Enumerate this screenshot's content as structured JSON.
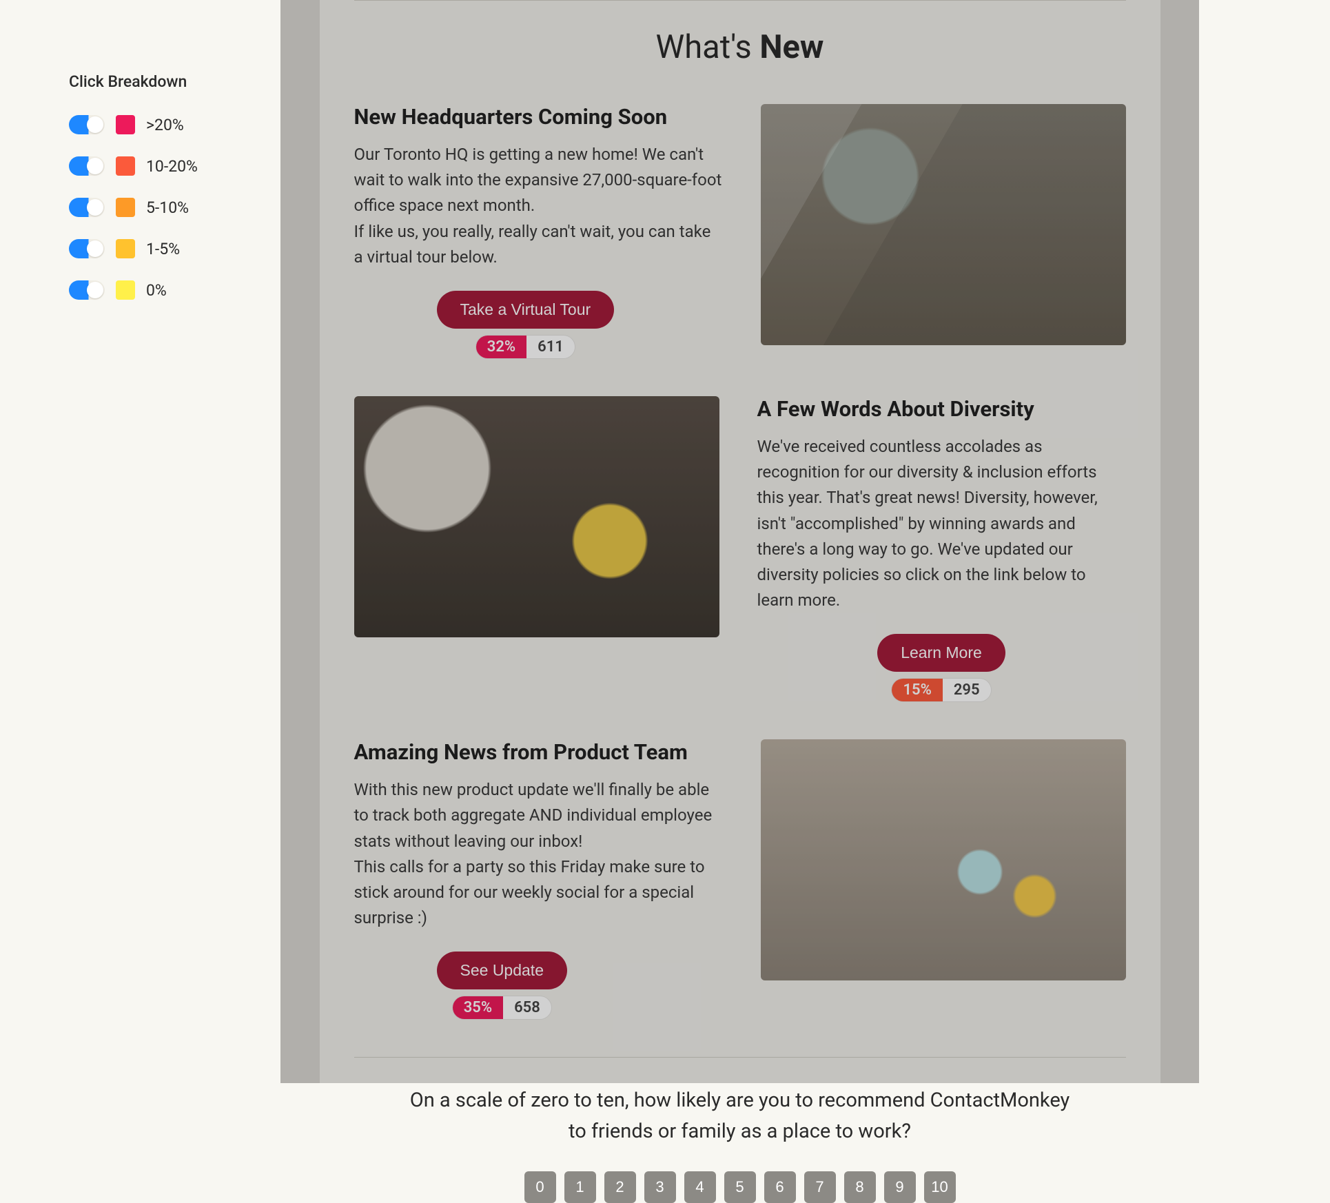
{
  "sidebar": {
    "title": "Click Breakdown",
    "legend": [
      {
        "label": ">20%",
        "color": "#ed1a5b"
      },
      {
        "label": "10-20%",
        "color": "#fb5a3b"
      },
      {
        "label": "5-10%",
        "color": "#fd9a27"
      },
      {
        "label": "1-5%",
        "color": "#ffc22e"
      },
      {
        "label": "0%",
        "color": "#fff04a"
      }
    ]
  },
  "colors": {
    "pct_pink": "#ed1a5b",
    "pct_orange": "#fb5a3b"
  },
  "email": {
    "section_title_plain": "What's ",
    "section_title_bold": "New",
    "articles": [
      {
        "title": "New Headquarters Coming Soon",
        "body": "Our Toronto HQ is getting a new home! We can't wait to walk into the expansive 27,000-square-foot office space next month.\nIf like us, you really, really can't wait, you can take a virtual tour below.",
        "cta": "Take a Virtual Tour",
        "pct": "32%",
        "pct_color_key": "pct_pink",
        "count": "611",
        "image_side": "right",
        "image_class": "ph-office",
        "image_alt": "office-interior-image"
      },
      {
        "title": "A Few Words About Diversity",
        "body": "We've received countless accolades as recognition for our diversity & inclusion efforts this year. That's great news! Diversity, however, isn't \"accomplished\" by winning awards and there's a long way to go. We've updated our diversity policies so click on the link below to learn more.",
        "cta": "Learn More",
        "pct": "15%",
        "pct_color_key": "pct_orange",
        "count": "295",
        "image_side": "left",
        "image_class": "ph-team",
        "image_alt": "team-high-five-image"
      },
      {
        "title": "Amazing News from Product Team",
        "body": "With this new product update we'll finally be able to track both aggregate AND individual employee stats without leaving our inbox!\nThis calls for a party so this Friday make sure to stick around for our weekly social for a special surprise :)",
        "cta": "See Update",
        "pct": "35%",
        "pct_color_key": "pct_pink",
        "count": "658",
        "image_side": "right",
        "image_class": "ph-workshop",
        "image_alt": "workshop-planning-image"
      }
    ],
    "nps": {
      "question_line1": "On a scale of zero to ten, how likely are you to recommend ContactMonkey",
      "question_line2": "to friends or family as a place to work?",
      "options": [
        "0",
        "1",
        "2",
        "3",
        "4",
        "5",
        "6",
        "7",
        "8",
        "9",
        "10"
      ]
    }
  }
}
